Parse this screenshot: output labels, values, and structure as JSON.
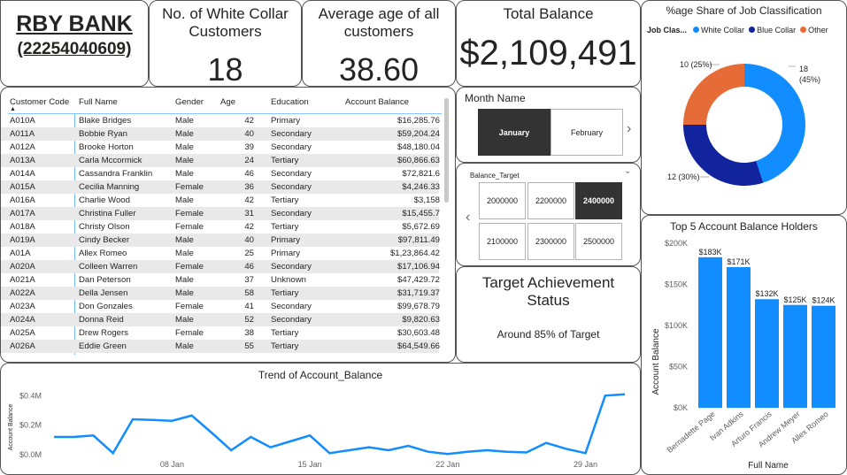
{
  "bank": {
    "name": "RBY BANK",
    "account": "(22254040609)"
  },
  "kpis": [
    {
      "title_line1": "No. of White Collar",
      "title_line2": "Customers",
      "value": "18"
    },
    {
      "title_line1": "Average age of all",
      "title_line2": "customers",
      "value": "38.60"
    },
    {
      "title_line1": "Total Balance",
      "title_line2": "",
      "value": "$2,109,491"
    }
  ],
  "table": {
    "headers": [
      "Customer Code",
      "Full Name",
      "Gender",
      "Age",
      "Education",
      "Account Balance"
    ],
    "rows": [
      [
        "A010A",
        "Blake Bridges",
        "Male",
        "42",
        "Primary",
        "$16,285.76"
      ],
      [
        "A011A",
        "Bobbie Ryan",
        "Male",
        "40",
        "Secondary",
        "$59,204.24"
      ],
      [
        "A012A",
        "Brooke Horton",
        "Male",
        "39",
        "Secondary",
        "$48,180.04"
      ],
      [
        "A013A",
        "Carla Mccormick",
        "Male",
        "24",
        "Tertiary",
        "$60,866.63"
      ],
      [
        "A014A",
        "Cassandra Franklin",
        "Male",
        "46",
        "Secondary",
        "$72,821.6"
      ],
      [
        "A015A",
        "Cecilia Manning",
        "Female",
        "36",
        "Secondary",
        "$4,246.33"
      ],
      [
        "A016A",
        "Charlie Wood",
        "Male",
        "42",
        "Tertiary",
        "$3,158"
      ],
      [
        "A017A",
        "Christina Fuller",
        "Female",
        "31",
        "Secondary",
        "$15,455.7"
      ],
      [
        "A018A",
        "Christy Olson",
        "Female",
        "42",
        "Tertiary",
        "$5,672.69"
      ],
      [
        "A019A",
        "Cindy Becker",
        "Male",
        "40",
        "Primary",
        "$97,811.49"
      ],
      [
        "A01A",
        "Allex Romeo",
        "Male",
        "25",
        "Primary",
        "$1,23,864.42"
      ],
      [
        "A020A",
        "Colleen Warren",
        "Female",
        "46",
        "Secondary",
        "$17,106.94"
      ],
      [
        "A021A",
        "Dan Peterson",
        "Male",
        "37",
        "Unknown",
        "$47,429.72"
      ],
      [
        "A022A",
        "Della Jensen",
        "Male",
        "58",
        "Tertiary",
        "$31,719.37"
      ],
      [
        "A023A",
        "Don Gonzales",
        "Female",
        "41",
        "Secondary",
        "$99,678.79"
      ],
      [
        "A024A",
        "Donna Reid",
        "Male",
        "52",
        "Secondary",
        "$9,820.63"
      ],
      [
        "A025A",
        "Drew Rogers",
        "Female",
        "38",
        "Tertiary",
        "$30,603.48"
      ],
      [
        "A026A",
        "Eddie Green",
        "Male",
        "55",
        "Tertiary",
        "$64,549.66"
      ]
    ]
  },
  "month_slicer": {
    "title": "Month Name",
    "options": [
      "January",
      "February"
    ],
    "selected": "January"
  },
  "balance_slicer": {
    "title": "Balance_Target",
    "options": [
      "2000000",
      "2200000",
      "2400000",
      "2100000",
      "2300000",
      "2500000"
    ],
    "selected": "2400000"
  },
  "target": {
    "title_line1": "Target Achievement",
    "title_line2": "Status",
    "status": "Around 85% of Target"
  },
  "colors": {
    "white_collar": "#118DFF",
    "blue_collar": "#12239E",
    "other": "#E66C37",
    "bar": "#118DFF",
    "line": "#118DFF",
    "selected_tile": "#333333"
  },
  "donut": {
    "title": "%age Share of Job Classification",
    "legend_title": "Job Clas...",
    "labels": [
      "18",
      "(45%)",
      "12 (30%)",
      "10 (25%)"
    ],
    "chart_data": {
      "type": "pie",
      "categories": [
        "White Collar",
        "Blue Collar",
        "Other"
      ],
      "values": [
        18,
        12,
        10
      ],
      "title": "%age Share of Job Classification"
    }
  },
  "bar_chart": {
    "title": "Top 5 Account Balance Holders",
    "ylabel": "Account Balance",
    "xlabel": "Full Name",
    "yticks": [
      "$200K",
      "$150K",
      "$100K",
      "$50K",
      "$0K"
    ],
    "data_labels": [
      "$183K",
      "$171K",
      "$132K",
      "$125K",
      "$124K"
    ],
    "chart_data": {
      "type": "bar",
      "categories": [
        "Bernadette Page",
        "Ivan Adkins",
        "Arturo Francis",
        "Andrew Meyer",
        "Allex Romeo"
      ],
      "values": [
        183000,
        171000,
        132000,
        125000,
        124000
      ],
      "title": "Top 5 Account Balance Holders",
      "xlabel": "Full Name",
      "ylabel": "Account Balance",
      "ylim": [
        0,
        200000
      ]
    }
  },
  "line_chart": {
    "title": "Trend of Account_Balance",
    "ylabel": "Account Balance",
    "yticks": [
      "$0.4M",
      "$0.2M",
      "$0.0M"
    ],
    "xticks": [
      "08 Jan",
      "15 Jan",
      "22 Jan",
      "29 Jan"
    ],
    "chart_data": {
      "type": "line",
      "x": [
        "2024-01-02",
        "2024-01-03",
        "2024-01-04",
        "2024-01-05",
        "2024-01-06",
        "2024-01-07",
        "2024-01-08",
        "2024-01-09",
        "2024-01-10",
        "2024-01-11",
        "2024-01-12",
        "2024-01-13",
        "2024-01-14",
        "2024-01-15",
        "2024-01-16",
        "2024-01-17",
        "2024-01-18",
        "2024-01-19",
        "2024-01-20",
        "2024-01-21",
        "2024-01-22",
        "2024-01-23",
        "2024-01-24",
        "2024-01-25",
        "2024-01-26",
        "2024-01-27",
        "2024-01-28",
        "2024-01-29",
        "2024-01-30",
        "2024-01-31"
      ],
      "values": [
        120000,
        120000,
        130000,
        10000,
        240000,
        235000,
        230000,
        265000,
        150000,
        30000,
        120000,
        50000,
        90000,
        130000,
        10000,
        30000,
        50000,
        30000,
        60000,
        20000,
        5000,
        20000,
        30000,
        20000,
        15000,
        80000,
        40000,
        10000,
        400000,
        410000
      ],
      "title": "Trend of Account_Balance",
      "ylabel": "Account Balance",
      "ylim": [
        0,
        450000
      ]
    }
  }
}
